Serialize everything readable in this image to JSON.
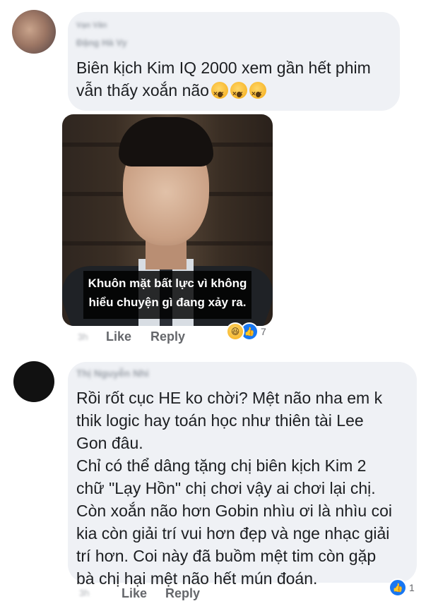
{
  "comments": [
    {
      "author_primary": "Vạn Vân",
      "author_secondary": "Đặng Hà Vy",
      "text_lines": [
        "Biên kịch Kim IQ 2000 xem gần hết phim",
        "vẫn thấy xoắn não"
      ],
      "emoji_icon": "dizzy-face-icon",
      "emoji_count": 3,
      "image": {
        "caption_lines": [
          "Khuôn mặt bất lực vì không",
          "hiểu chuyện gì đang xảy ra."
        ]
      },
      "time": "3h",
      "like_label": "Like",
      "reply_label": "Reply",
      "reactions": [
        "haha-reaction-icon",
        "like-reaction-icon"
      ],
      "reaction_count": "7"
    },
    {
      "author": "Thị Nguyễn Nhi",
      "text_lines": [
        "Rồi rốt cục HE ko chời? Mệt não nha em k",
        "thik logic hay toán học như thiên tài Lee",
        "Gon đâu.",
        "Chỉ có thể dâng tặng chị biên kịch Kim 2",
        "chữ \"Lạy Hồn\" chị chơi vậy ai chơi lại chị.",
        "Còn xoắn não hơn Gobin nhìu ơi là nhìu coi",
        "kia còn giải trí vui hơn đẹp và nge nhạc giải",
        "trí hơn. Coi này đã buồm mệt tim còn gặp",
        "bà chị hại mệt não hết mún đoán."
      ],
      "time": "3h",
      "like_label": "Like",
      "reply_label": "Reply",
      "reactions": [
        "like-reaction-icon"
      ],
      "reaction_count": "1"
    }
  ],
  "colors": {
    "bubble": "#eff1f5",
    "action_text": "#65676b",
    "like_blue": "#1877f2"
  }
}
